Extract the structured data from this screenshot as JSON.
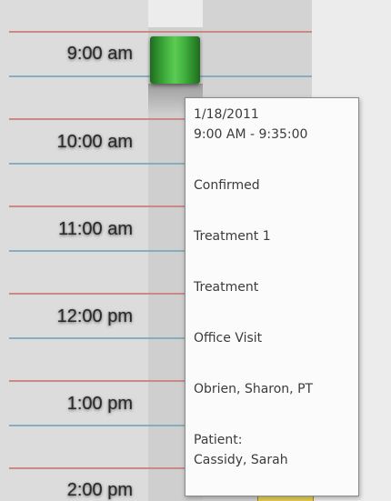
{
  "schedule": {
    "times": [
      "9:00 am",
      "10:00 am",
      "11:00 am",
      "12:00 pm",
      "1:00 pm",
      "2:00 pm"
    ]
  },
  "tooltip": {
    "date": "1/18/2011",
    "time_range": "9:00 AM - 9:35:00",
    "status": "Confirmed",
    "room": "Treatment 1",
    "category": "Treatment",
    "visit_type": "Office Visit",
    "provider": "Obrien, Sharon, PT",
    "patient_label": "Patient:",
    "patient_name": "Cassidy, Sarah"
  },
  "colors": {
    "appointment_confirmed": "#3fae3c",
    "appointment_other": "#e3c43a",
    "hour_line": "#c98a86",
    "half_hour_line": "#86aebf"
  }
}
